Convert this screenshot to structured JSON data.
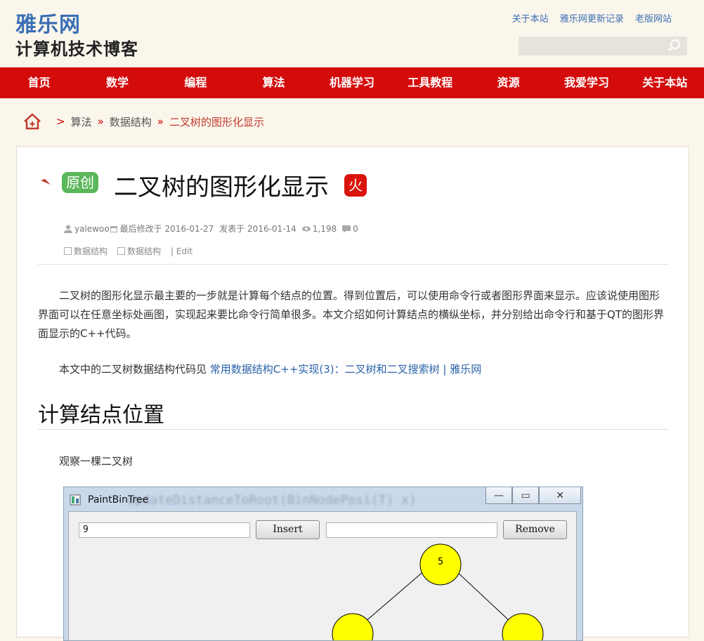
{
  "site": {
    "name": "雅乐网",
    "subtitle": "计算机技术博客"
  },
  "toplinks": [
    "关于本站",
    "雅乐网更新记录",
    "老版网站"
  ],
  "search": {
    "icon": "search-icon",
    "placeholder": ""
  },
  "nav": [
    "首页",
    "数学",
    "编程",
    "算法",
    "机器学习",
    "工具教程",
    "资源",
    "我爱学习",
    "关于本站"
  ],
  "breadcrumb": {
    "sep1": ">",
    "item1": "算法",
    "sep2": "»",
    "item2": "数据结构",
    "sep3": "»",
    "current": "二叉树的图形化显示"
  },
  "post": {
    "badge": "原创",
    "title": "二叉树的图形化显示",
    "hot_badge": "火",
    "author": "yalewoo",
    "modified": "最后修改于 2016-01-27",
    "published": "发表于 2016-01-14",
    "views": "1,198",
    "comments": "0",
    "tags": [
      "数据结构",
      "数据结构"
    ],
    "edit": "| Edit",
    "para1": "二叉树的图形化显示最主要的一步就是计算每个结点的位置。得到位置后，可以使用命令行或者图形界面来显示。应该说使用图形界面可以在任意坐标处画图，实现起来要比命令行简单很多。本文介绍如何计算结点的横纵坐标，并分别给出命令行和基于QT的图形界面显示的C++代码。",
    "para2_text": "本文中的二叉树数据结构代码见 ",
    "para2_link": "常用数据结构C++实现(3)：二叉树和二叉搜索树 | 雅乐网",
    "heading": "计算结点位置",
    "para3": "观察一棵二叉树"
  },
  "app_window": {
    "title": "PaintBinTree",
    "background_code": "updateDistanceToRoot(BinNodePosi(T) x)",
    "insert_value": "9",
    "insert_label": "Insert",
    "remove_value": "",
    "remove_label": "Remove",
    "root_node": "5",
    "node_color": "#ffff00",
    "controls": {
      "minimize": "—",
      "maximize": "▭",
      "close": "✕"
    }
  },
  "colors": {
    "brand_blue": "#3a6fb5",
    "nav_red": "#d40b0b",
    "original_green": "#5bb75b",
    "hot_red": "#d9140c"
  }
}
